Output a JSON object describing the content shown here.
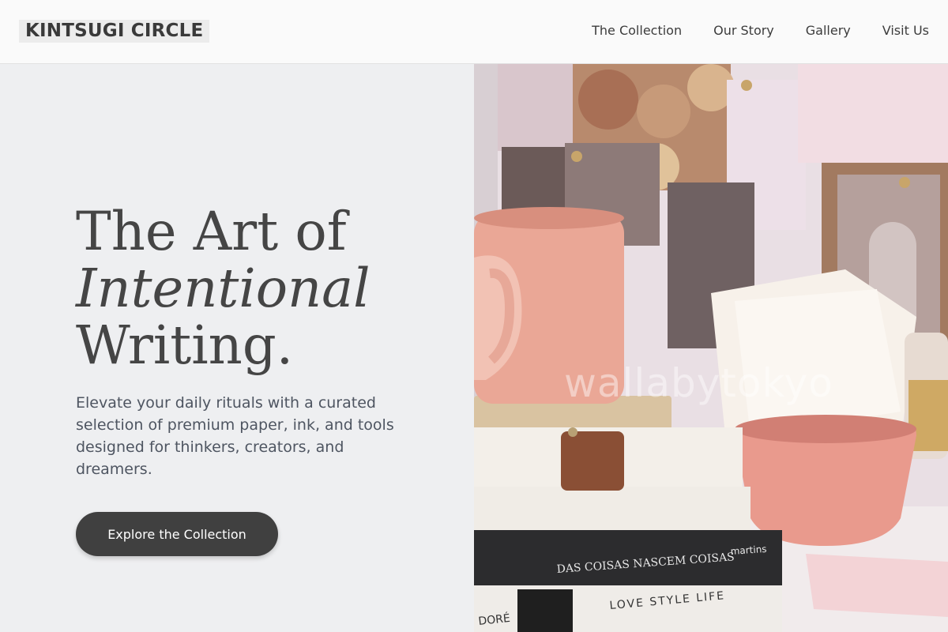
{
  "header": {
    "logo": "KINTSUGI CIRCLE",
    "nav": [
      {
        "label": "The Collection"
      },
      {
        "label": "Our Story"
      },
      {
        "label": "Gallery"
      },
      {
        "label": "Visit Us"
      }
    ]
  },
  "hero": {
    "headline_line1": "The Art of",
    "headline_line2": "Intentional",
    "headline_line3": "Writing.",
    "subcopy": "Elevate your daily rituals with a curated selection of premium paper, ink, and tools designed for thinkers, creators, and dreamers.",
    "cta_label": "Explore the Collection"
  },
  "photo": {
    "watermark": "wallabytokyo",
    "book_titles": {
      "black_book": "DAS COISAS NASCEM COISAS",
      "black_book_publisher": "martins",
      "bottom_book": "LOVE  STYLE  LIFE",
      "left_book": "DORÉ"
    }
  },
  "colors": {
    "cta_bg": "#404040",
    "left_bg": "#eeeff1",
    "mug": "#eaa796"
  }
}
